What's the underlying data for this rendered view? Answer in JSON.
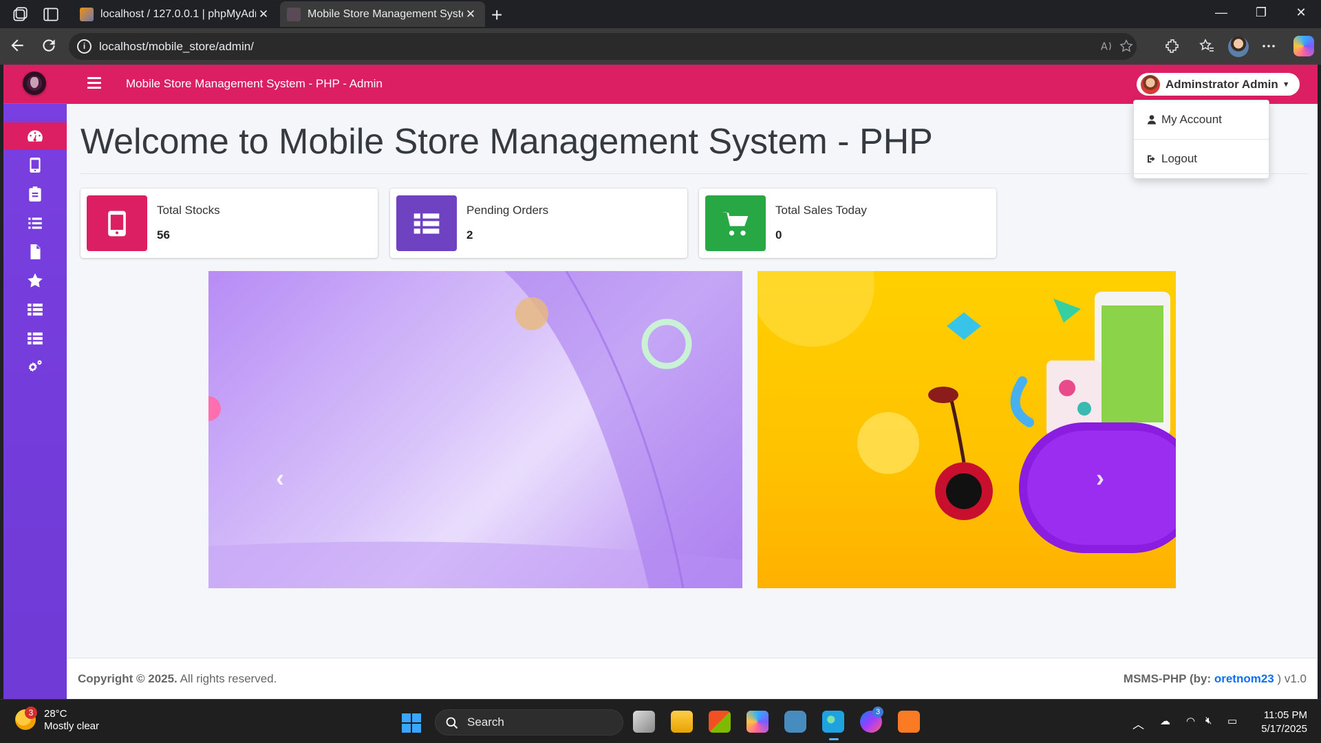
{
  "browser": {
    "tabs": [
      {
        "title": "localhost / 127.0.0.1 | phpMyAdm",
        "close": "✕"
      },
      {
        "title": "Mobile Store Management Syster",
        "close": "✕"
      }
    ],
    "new_tab": "+",
    "url": "localhost/mobile_store/admin/",
    "window_controls": {
      "minimize": "—",
      "restore": "❐",
      "close": "✕"
    }
  },
  "app": {
    "nav_title": "Mobile Store Management System - PHP - Admin",
    "user_name": "Adminstrator Admin",
    "dropdown": {
      "my_account": "My Account",
      "logout": "Logout"
    },
    "sidebar_icons": [
      "dashboard-icon",
      "mobile-icon",
      "clipboard-icon",
      "list-icon",
      "file-icon",
      "star-icon",
      "table-icon",
      "table-icon",
      "cogs-icon"
    ],
    "page_title": "Welcome to Mobile Store Management System - PHP",
    "info_boxes": [
      {
        "label": "Total Stocks",
        "value": "56",
        "icon": "mobile-icon",
        "color": "#dc1e62"
      },
      {
        "label": "Pending Orders",
        "value": "2",
        "icon": "table-icon",
        "color": "#6f42c1"
      },
      {
        "label": "Total Sales Today",
        "value": "0",
        "icon": "cart-icon",
        "color": "#28a745"
      }
    ],
    "footer": {
      "copyright_bold": "Copyright © 2025.",
      "copyright_rest": " All rights reserved.",
      "credit_prefix": "MSMS-PHP (by: ",
      "credit_author": "oretnom23",
      "credit_suffix": " ) v1.0"
    }
  },
  "taskbar": {
    "weather_badge": "3",
    "temperature": "28°C",
    "condition": "Mostly clear",
    "search_label": "Search",
    "messenger_badge": "3",
    "time": "11:05 PM",
    "date": "5/17/2025"
  },
  "colors": {
    "primary": "#dc1e62",
    "sidebar": "#6f3ad6",
    "purple": "#6f42c1",
    "success": "#28a745"
  }
}
